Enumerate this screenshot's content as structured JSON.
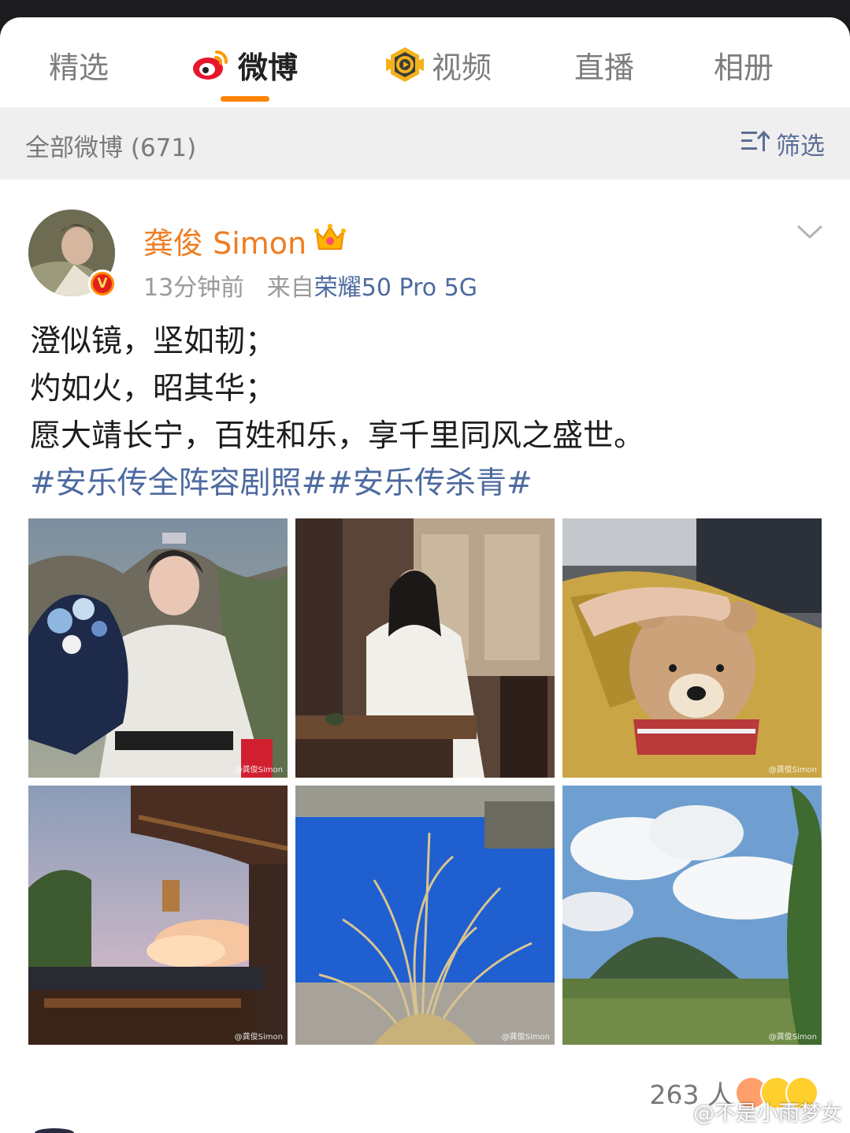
{
  "tabs": [
    {
      "label": "精选",
      "icon": "none",
      "active": false
    },
    {
      "label": "微博",
      "icon": "weibo-logo-icon",
      "active": true
    },
    {
      "label": "视频",
      "icon": "video-play-icon",
      "active": false
    },
    {
      "label": "直播",
      "icon": "none",
      "active": false
    },
    {
      "label": "相册",
      "icon": "none",
      "active": false
    }
  ],
  "filter": {
    "count_label": "全部微博 (671)",
    "filter_label": "筛选"
  },
  "post": {
    "author": "龚俊 Simon",
    "time": "13分钟前",
    "source_prefix": "来自",
    "device": "荣耀50 Pro 5G",
    "lines": [
      "澄似镜，坚如韧；",
      "灼如火，昭其华；",
      "愿大靖长宁，百姓和乐，享千里同风之盛世。"
    ],
    "hashtags": "#安乐传全阵容剧照##安乐传杀青#",
    "photos": [
      {
        "name": "photo-costume-flowers",
        "watermark": "@龚俊Simon"
      },
      {
        "name": "photo-costume-seated",
        "watermark": ""
      },
      {
        "name": "photo-teddy-bear",
        "watermark": "@龚俊Simon"
      },
      {
        "name": "photo-palace-sunset",
        "watermark": "@龚俊Simon"
      },
      {
        "name": "photo-grass-bluescreen",
        "watermark": "@龚俊Simon"
      },
      {
        "name": "photo-mountain-field",
        "watermark": "@龚俊Simon"
      }
    ],
    "reaction_count": "263 人"
  },
  "image_watermark": "@不是小雨梦女",
  "colors": {
    "accent": "#ff8200",
    "username": "#ef7d22",
    "link": "#4d6aa0"
  }
}
